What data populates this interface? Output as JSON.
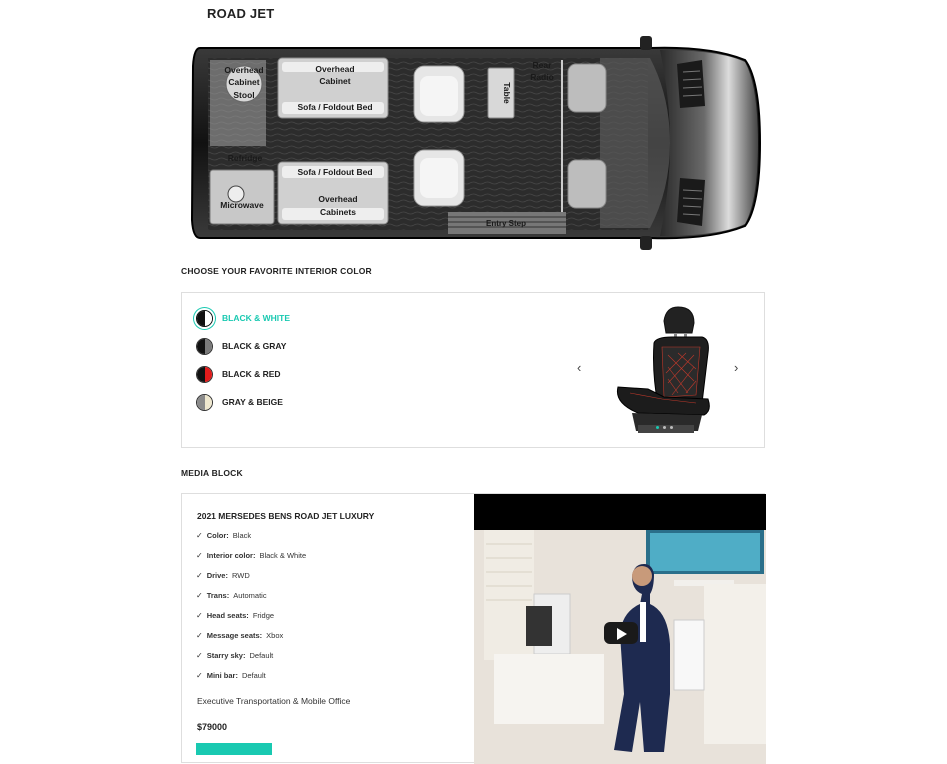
{
  "page_title": "ROAD JET",
  "floorplan": {
    "labels": {
      "overhead_cabinet_stool": [
        "Overhead",
        "Cabinet",
        "Stool"
      ],
      "overhead_cabinet_top": [
        "Overhead",
        "Cabinet"
      ],
      "sofa_top": "Sofa / Foldout Bed",
      "sofa_bottom": "Sofa / Foldout Bed",
      "overhead_cabinets_bottom": [
        "Overhead",
        "Cabinets"
      ],
      "rear_radio": [
        "Rear",
        "Radio"
      ],
      "table": "Table",
      "refridge": "Refridge",
      "microwave": "Microwave",
      "entry_step": "Entry Step"
    }
  },
  "interior": {
    "heading": "CHOOSE YOUR FAVORITE INTERIOR COLOR",
    "options": [
      {
        "label": "BLACK & WHITE",
        "left": "#111111",
        "right": "#ffffff",
        "selected": true
      },
      {
        "label": "BLACK & GRAY",
        "left": "#111111",
        "right": "#7a7a7a",
        "selected": false
      },
      {
        "label": "BLACK & RED",
        "left": "#111111",
        "right": "#e31b1b",
        "selected": false
      },
      {
        "label": "GRAY & BEIGE",
        "left": "#8a8a8a",
        "right": "#efe8cf",
        "selected": false
      }
    ],
    "prev_arrow": "‹",
    "next_arrow": "›",
    "accent_color": "#19c9b1"
  },
  "media": {
    "heading": "MEDIA BLOCK",
    "title": "2021 MERSEDES BENS ROAD JET LUXURY",
    "specs": [
      {
        "k": "Color:",
        "v": "Black"
      },
      {
        "k": "Interior color:",
        "v": "Black & White"
      },
      {
        "k": "Drive:",
        "v": "RWD"
      },
      {
        "k": "Trans:",
        "v": "Automatic"
      },
      {
        "k": "Head seats:",
        "v": "Fridge"
      },
      {
        "k": "Message seats:",
        "v": "Xbox"
      },
      {
        "k": "Starry sky:",
        "v": "Default"
      },
      {
        "k": "Mini bar:",
        "v": "Default"
      }
    ],
    "check_glyph": "✓",
    "description": "Executive Transportation & Mobile Office",
    "price": "$79000"
  }
}
